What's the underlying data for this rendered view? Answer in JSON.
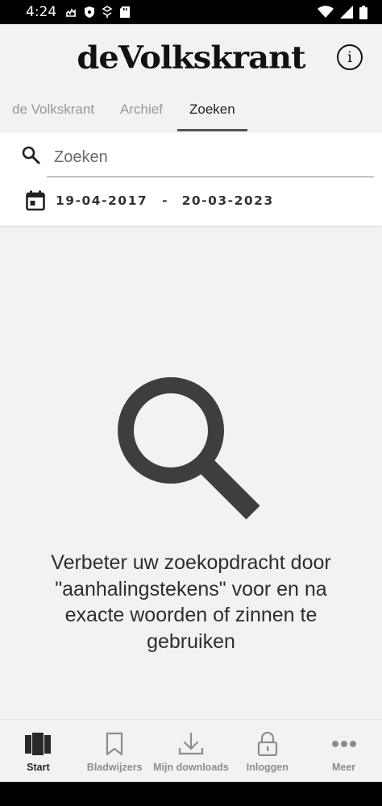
{
  "status_bar": {
    "time": "4:24"
  },
  "header": {
    "logo": "deVolkskrant",
    "info_glyph": "i"
  },
  "tabs": [
    {
      "label": "de Volkskrant",
      "active": false
    },
    {
      "label": "Archief",
      "active": false
    },
    {
      "label": "Zoeken",
      "active": true
    }
  ],
  "search": {
    "placeholder": "Zoeken",
    "value": "",
    "date_from": "19-04-2017",
    "date_separator": "-",
    "date_to": "20-03-2023"
  },
  "empty_state": {
    "hint": "Verbeter uw zoekopdracht door \"aanhalingstekens\" voor en na exacte woorden of zinnen te gebruiken",
    "icon": "magnifier-icon"
  },
  "bottom_nav": [
    {
      "label": "Start",
      "icon": "newspapers-icon",
      "active": true
    },
    {
      "label": "Bladwijzers",
      "icon": "bookmark-icon",
      "active": false
    },
    {
      "label": "Mijn downloads",
      "icon": "download-icon",
      "active": false
    },
    {
      "label": "Inloggen",
      "icon": "lock-icon",
      "active": false
    },
    {
      "label": "Meer",
      "icon": "more-icon",
      "active": false
    }
  ],
  "colors": {
    "background": "#f3f1f4",
    "text_dark": "#2f2d30",
    "tab_inactive": "#9a979b",
    "nav_inactive": "#8f8c90"
  }
}
